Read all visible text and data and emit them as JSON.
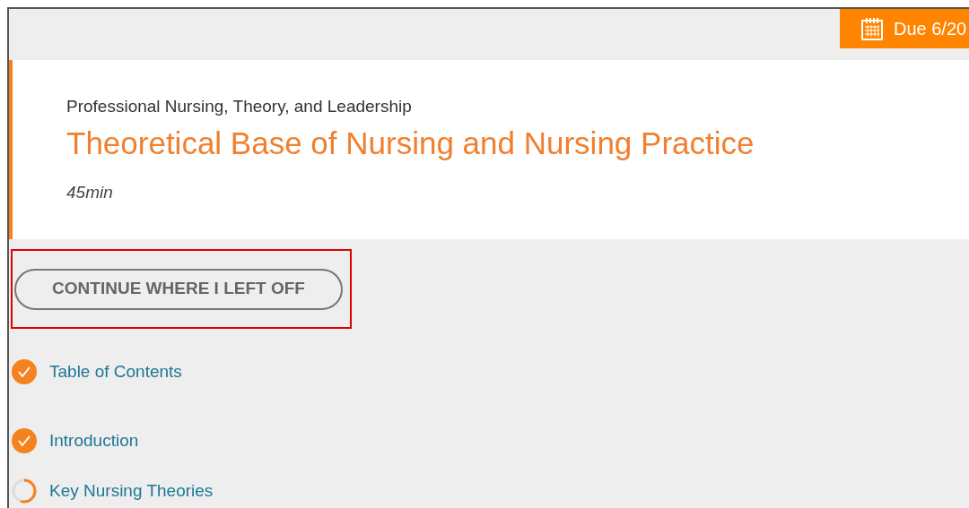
{
  "due_badge": {
    "label": "Due 6/20"
  },
  "header": {
    "course": "Professional Nursing, Theory, and Leadership",
    "title": "Theoretical Base of Nursing and Nursing Practice",
    "duration": "45min"
  },
  "continue_button": {
    "label": "CONTINUE WHERE I LEFT OFF",
    "highlighted": true
  },
  "sections": [
    {
      "label": "Table of Contents",
      "completed": true
    },
    {
      "label": "Introduction",
      "completed": true
    },
    {
      "label": "Key Nursing Theories",
      "completed": false
    }
  ]
}
